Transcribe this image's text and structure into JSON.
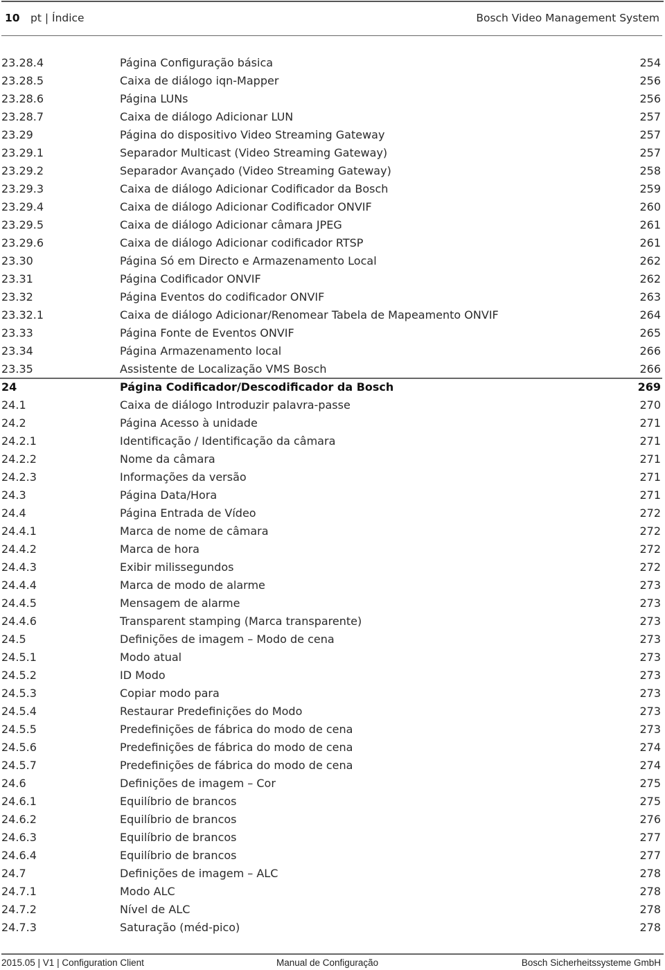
{
  "header": {
    "page_number": "10",
    "section": "pt | Índice",
    "product": "Bosch Video Management System"
  },
  "toc": [
    {
      "num": "23.28.4",
      "title": "Página Configuração básica",
      "page": "254"
    },
    {
      "num": "23.28.5",
      "title": "Caixa de diálogo iqn-Mapper",
      "page": "256"
    },
    {
      "num": "23.28.6",
      "title": "Página LUNs",
      "page": "256"
    },
    {
      "num": "23.28.7",
      "title": "Caixa de diálogo Adicionar LUN",
      "page": "257"
    },
    {
      "num": "23.29",
      "title": "Página do dispositivo Video Streaming Gateway",
      "page": "257"
    },
    {
      "num": "23.29.1",
      "title": "Separador Multicast (Video Streaming Gateway)",
      "page": "257"
    },
    {
      "num": "23.29.2",
      "title": "Separador Avançado (Video Streaming Gateway)",
      "page": "258"
    },
    {
      "num": "23.29.3",
      "title": "Caixa de diálogo Adicionar Codificador da Bosch",
      "page": "259"
    },
    {
      "num": "23.29.4",
      "title": "Caixa de diálogo Adicionar Codificador ONVIF",
      "page": "260"
    },
    {
      "num": "23.29.5",
      "title": "Caixa de diálogo Adicionar câmara JPEG",
      "page": "261"
    },
    {
      "num": "23.29.6",
      "title": "Caixa de diálogo Adicionar codificador RTSP",
      "page": "261"
    },
    {
      "num": "23.30",
      "title": "Página Só em Directo e Armazenamento Local",
      "page": "262"
    },
    {
      "num": "23.31",
      "title": "Página Codificador ONVIF",
      "page": "262"
    },
    {
      "num": "23.32",
      "title": "Página Eventos do codificador ONVIF",
      "page": "263"
    },
    {
      "num": "23.32.1",
      "title": "Caixa de diálogo Adicionar/Renomear Tabela de Mapeamento ONVIF",
      "page": "264"
    },
    {
      "num": "23.33",
      "title": "Página Fonte de Eventos ONVIF",
      "page": "265"
    },
    {
      "num": "23.34",
      "title": "Página Armazenamento local",
      "page": "266"
    },
    {
      "num": "23.35",
      "title": "Assistente de Localização VMS Bosch",
      "page": "266"
    },
    {
      "num": "24",
      "title": "Página Codificador/Descodificador da Bosch",
      "page": "269",
      "chapter": true
    },
    {
      "num": "24.1",
      "title": "Caixa de diálogo Introduzir palavra-passe",
      "page": "270"
    },
    {
      "num": "24.2",
      "title": "Página Acesso à unidade",
      "page": "271"
    },
    {
      "num": "24.2.1",
      "title": "Identificação / Identificação da câmara",
      "page": "271"
    },
    {
      "num": "24.2.2",
      "title": "Nome da câmara",
      "page": "271"
    },
    {
      "num": "24.2.3",
      "title": "Informações da versão",
      "page": "271"
    },
    {
      "num": "24.3",
      "title": "Página Data/Hora",
      "page": "271"
    },
    {
      "num": "24.4",
      "title": "Página Entrada de Vídeo",
      "page": "272"
    },
    {
      "num": "24.4.1",
      "title": "Marca de nome de câmara",
      "page": "272"
    },
    {
      "num": "24.4.2",
      "title": "Marca de hora",
      "page": "272"
    },
    {
      "num": "24.4.3",
      "title": "Exibir milissegundos",
      "page": "272"
    },
    {
      "num": "24.4.4",
      "title": "Marca de modo de alarme",
      "page": "273"
    },
    {
      "num": "24.4.5",
      "title": "Mensagem de alarme",
      "page": "273"
    },
    {
      "num": "24.4.6",
      "title": "Transparent stamping (Marca transparente)",
      "page": "273"
    },
    {
      "num": "24.5",
      "title": "Definições de imagem – Modo de cena",
      "page": "273"
    },
    {
      "num": "24.5.1",
      "title": "Modo atual",
      "page": "273"
    },
    {
      "num": "24.5.2",
      "title": "ID Modo",
      "page": "273"
    },
    {
      "num": "24.5.3",
      "title": "Copiar modo para",
      "page": "273"
    },
    {
      "num": "24.5.4",
      "title": "Restaurar Predefinições do Modo",
      "page": "273"
    },
    {
      "num": "24.5.5",
      "title": "Predefinições de fábrica do modo de cena",
      "page": "273"
    },
    {
      "num": "24.5.6",
      "title": "Predefinições de fábrica do modo de cena",
      "page": "274"
    },
    {
      "num": "24.5.7",
      "title": "Predefinições de fábrica do modo de cena",
      "page": "274"
    },
    {
      "num": "24.6",
      "title": "Definições de imagem – Cor",
      "page": "275"
    },
    {
      "num": "24.6.1",
      "title": "Equilíbrio de brancos",
      "page": "275"
    },
    {
      "num": "24.6.2",
      "title": "Equilíbrio de brancos",
      "page": "276"
    },
    {
      "num": "24.6.3",
      "title": "Equilíbrio de brancos",
      "page": "277"
    },
    {
      "num": "24.6.4",
      "title": "Equilíbrio de brancos",
      "page": "277"
    },
    {
      "num": "24.7",
      "title": "Definições de imagem – ALC",
      "page": "278"
    },
    {
      "num": "24.7.1",
      "title": "Modo ALC",
      "page": "278"
    },
    {
      "num": "24.7.2",
      "title": "Nível de ALC",
      "page": "278"
    },
    {
      "num": "24.7.3",
      "title": "Saturação (méd-pico)",
      "page": "278"
    }
  ],
  "footer": {
    "left": "2015.05 | V1 | Configuration Client",
    "middle": "Manual de Configuração",
    "right": "Bosch Sicherheitssysteme GmbH"
  }
}
